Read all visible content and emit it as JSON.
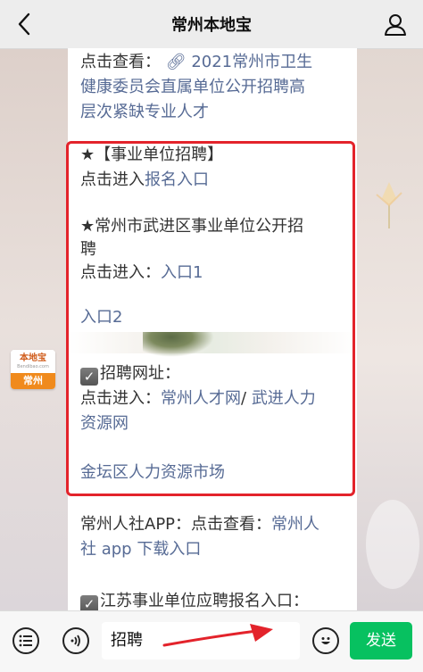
{
  "navbar": {
    "title": "常州本地宝",
    "back_icon": "chevron-left-icon",
    "profile_icon": "person-icon"
  },
  "article": {
    "para1_line1_prefix": "点击查看：",
    "para1_line1_link": "2021常州市卫生",
    "para1_line2": "健康委员会直属单位公开招聘高",
    "para1_line3": "层次紧缺专业人才",
    "sec1_title": "★【事业单位招聘】",
    "sec1_line_prefix": "点击进入",
    "sec1_link": "报名入口",
    "sec2_title_line1": "★常州市武进区事业单位公开招",
    "sec2_title_line2": "聘",
    "sec2_line_prefix": "点击进入：",
    "sec2_link1": "入口1",
    "sec2_link2": "入口2",
    "sec3_title": "招聘网址：",
    "sec3_line_prefix": "点击进入：",
    "sec3_link1": "常州人才网",
    "sec3_sep": "/",
    "sec3_link2_part1": "武进人力",
    "sec3_link2_part2": "资源网",
    "sec3_link3": "金坛区人力资源市场",
    "para4_line1_prefix": "常州人社APP：点击查看：",
    "para4_line1_link": "常州人",
    "para4_line2_link": "社 app 下载入口",
    "para5_title": "江苏事业单位应聘报名入口："
  },
  "badge": {
    "logo_text": "本地宝",
    "logo_url": "Bendibao.com",
    "city": "常州"
  },
  "bottombar": {
    "menu_icon": "menu-list-icon",
    "voice_icon": "voice-icon",
    "input_value": "招聘",
    "emoji_icon": "smiley-icon",
    "send_label": "发送"
  },
  "colors": {
    "highlight_border": "#e3232b",
    "link": "#576b95",
    "send": "#07c160",
    "badge_orange": "#f08a1c"
  }
}
